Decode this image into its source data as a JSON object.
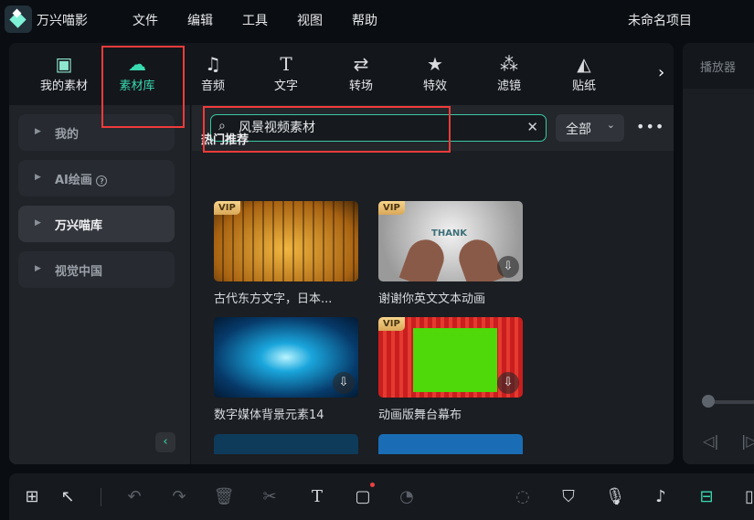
{
  "app": {
    "name": "万兴喵影",
    "project_title": "未命名项目"
  },
  "menu": [
    "文件",
    "编辑",
    "工具",
    "视图",
    "帮助"
  ],
  "tabs": [
    {
      "label": "我的素材",
      "icon": "image-icon"
    },
    {
      "label": "素材库",
      "icon": "cloud-folder-icon",
      "active": true
    },
    {
      "label": "音频",
      "icon": "music-note-icon"
    },
    {
      "label": "文字",
      "icon": "text-icon"
    },
    {
      "label": "转场",
      "icon": "transition-icon"
    },
    {
      "label": "特效",
      "icon": "magic-star-icon"
    },
    {
      "label": "滤镜",
      "icon": "filter-circles-icon"
    },
    {
      "label": "贴纸",
      "icon": "sticker-icon"
    }
  ],
  "sidebar": {
    "items": [
      {
        "label": "我的"
      },
      {
        "label": "AI绘画"
      },
      {
        "label": "万兴喵库",
        "active": true
      },
      {
        "label": "视觉中国"
      }
    ]
  },
  "search": {
    "value": "风景视频素材",
    "filter": "全部"
  },
  "section_title": "热门推荐",
  "cards": [
    {
      "title": "古代东方文字，日本...",
      "vip": "VIP",
      "download": false
    },
    {
      "title": "谢谢你英文文本动画",
      "vip": "VIP",
      "download": true,
      "thumb_text": "THANK"
    },
    {
      "title": "数字媒体背景元素14",
      "vip": "",
      "download": true
    },
    {
      "title": "动画版舞台幕布",
      "vip": "VIP",
      "download": true
    }
  ],
  "player": {
    "title": "播放器"
  },
  "colors": {
    "accent": "#3ad9b0",
    "highlight_box": "#ef3b3b",
    "background": "#0a0d11"
  }
}
